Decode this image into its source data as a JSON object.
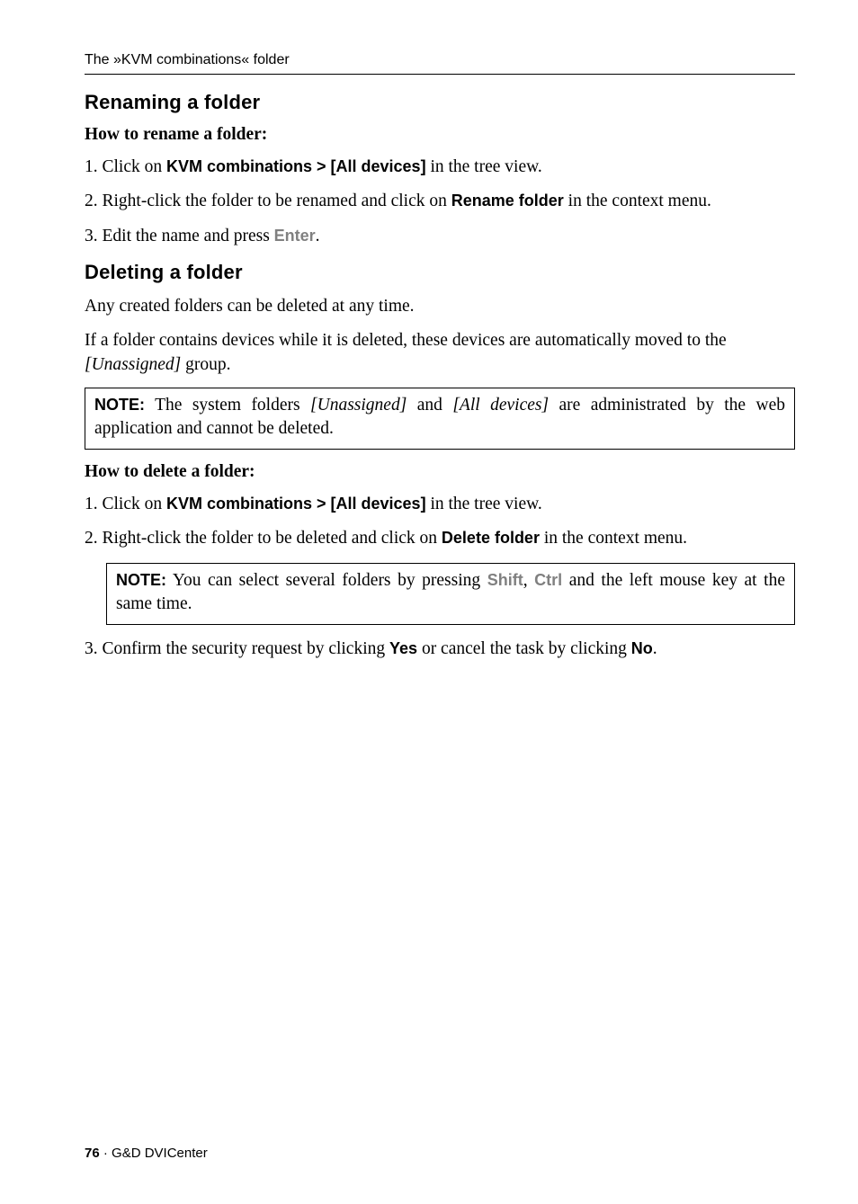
{
  "header": {
    "running": "The »KVM combinations« folder"
  },
  "section1": {
    "title": "Renaming a folder",
    "howto": "How to rename a folder:",
    "step1_num": "1.",
    "step1_a": "Click on ",
    "step1_b": "KVM combinations > [All devices]",
    "step1_c": " in the tree view.",
    "step2_num": "2.",
    "step2_a": "Right-click the folder to be renamed and click on ",
    "step2_b": "Rename folder",
    "step2_c": " in the context menu.",
    "step3_num": "3.",
    "step3_a": "Edit the name and press ",
    "step3_key": "Enter",
    "step3_c": "."
  },
  "section2": {
    "title": "Deleting a folder",
    "para1": "Any created folders can be deleted at any time.",
    "para2_a": "If a folder contains devices while it is deleted, these devices are automatically moved to the ",
    "para2_b": "[Unassigned]",
    "para2_c": " group.",
    "note1_label": "NOTE:",
    "note1_a": " The system folders ",
    "note1_b": "[Unassigned]",
    "note1_c": " and ",
    "note1_d": "[All devices]",
    "note1_e": " are administrated by the web application and cannot be deleted.",
    "howto": "How to delete a folder:",
    "step1_num": "1.",
    "step1_a": "Click on ",
    "step1_b": "KVM combinations > [All devices]",
    "step1_c": " in the tree view.",
    "step2_num": "2.",
    "step2_a": "Right-click the folder to be deleted and click on ",
    "step2_b": "Delete folder",
    "step2_c": " in the context menu.",
    "note2_label": "NOTE:",
    "note2_a": " You can select several folders by pressing ",
    "note2_key1": "Shift",
    "note2_b": ", ",
    "note2_key2": "Ctrl",
    "note2_c": " and the left mouse key at the same time.",
    "step3_num": "3.",
    "step3_a": "Confirm the security request by clicking ",
    "step3_b": "Yes",
    "step3_c": " or cancel the task by clicking ",
    "step3_d": "No",
    "step3_e": "."
  },
  "footer": {
    "page": "76",
    "sep": " · ",
    "doc": "G&D DVICenter"
  }
}
